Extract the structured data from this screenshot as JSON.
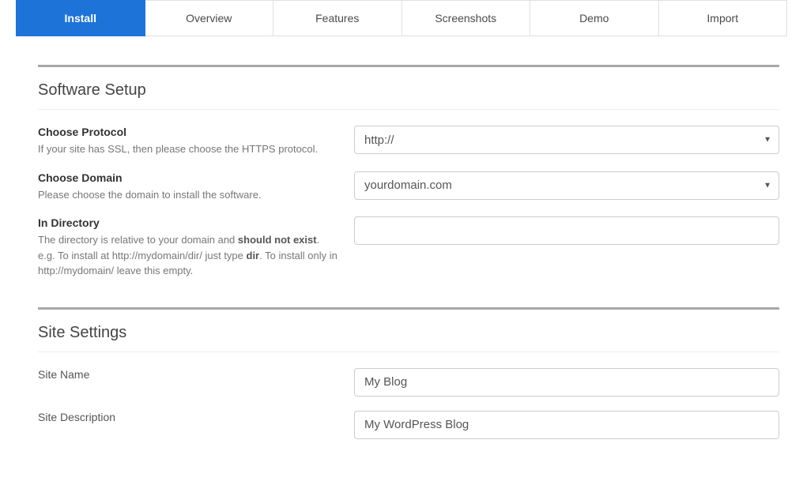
{
  "tabs": {
    "install": "Install",
    "overview": "Overview",
    "features": "Features",
    "screenshots": "Screenshots",
    "demo": "Demo",
    "import": "Import"
  },
  "sections": {
    "software_setup": {
      "title": "Software Setup",
      "protocol": {
        "label": "Choose Protocol",
        "hint": "If your site has SSL, then please choose the HTTPS protocol.",
        "value": "http://"
      },
      "domain": {
        "label": "Choose Domain",
        "hint": "Please choose the domain to install the software.",
        "value": "yourdomain.com"
      },
      "directory": {
        "label": "In Directory",
        "hint_p1": "The directory is relative to your domain and ",
        "hint_b1": "should not exist",
        "hint_p2": ". e.g. To install at http://mydomain/dir/ just type ",
        "hint_b2": "dir",
        "hint_p3": ". To install only in http://mydomain/ leave this empty.",
        "value": ""
      }
    },
    "site_settings": {
      "title": "Site Settings",
      "site_name": {
        "label": "Site Name",
        "value": "My Blog"
      },
      "site_description": {
        "label": "Site Description",
        "value": "My WordPress Blog"
      }
    }
  }
}
